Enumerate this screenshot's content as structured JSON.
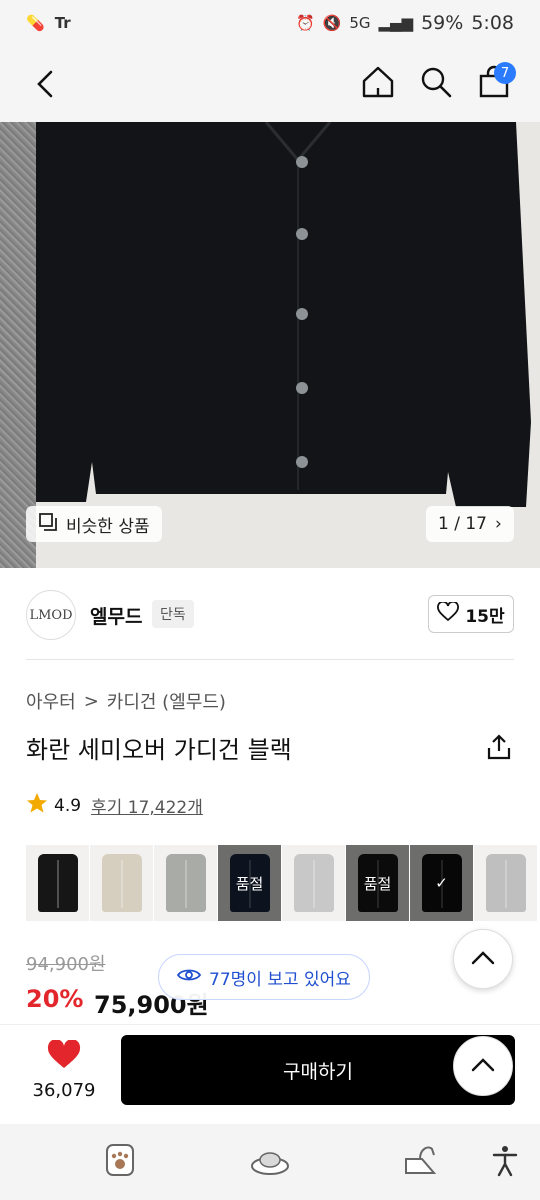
{
  "status_bar": {
    "battery": "59%",
    "time": "5:08",
    "network": "5G"
  },
  "header": {
    "cart_count": "7",
    "icons": [
      "back-icon",
      "home-icon",
      "search-icon",
      "cart-icon"
    ]
  },
  "hero": {
    "similar_label": "비슷한 상품",
    "page_indicator": "1 / 17",
    "chevron": "›"
  },
  "brand": {
    "logo_text": "LMOD",
    "name": "엘무드",
    "badge": "단독",
    "likes": "15만"
  },
  "breadcrumb": {
    "level1": "아우터",
    "separator": ">",
    "level2": "카디건 (엘무드)"
  },
  "product": {
    "title": "화란 세미오버 가디건 블랙",
    "rating": "4.9",
    "reviews": "후기 17,422개"
  },
  "swatches": [
    {
      "color": "#161616",
      "overlay": ""
    },
    {
      "color": "#d6cfc0",
      "overlay": ""
    },
    {
      "color": "#a9aba6",
      "overlay": ""
    },
    {
      "color": "#1d2a44",
      "overlay": "품절"
    },
    {
      "color": "#c8c8c8",
      "overlay": ""
    },
    {
      "color": "#1a1a1a",
      "overlay": "품절"
    },
    {
      "color": "#111111",
      "overlay": "✓"
    },
    {
      "color": "#bfbfbf",
      "overlay": ""
    }
  ],
  "price": {
    "original": "94,900원",
    "discount": "20%",
    "final": "75,900원",
    "viewers": "77명이 보고 있어요"
  },
  "bottom": {
    "wish_count": "36,079",
    "buy_label": "구매하기"
  },
  "colors": {
    "accent_blue": "#2b7bff",
    "discount_red": "#e3262c",
    "heart_red": "#e3262c"
  }
}
